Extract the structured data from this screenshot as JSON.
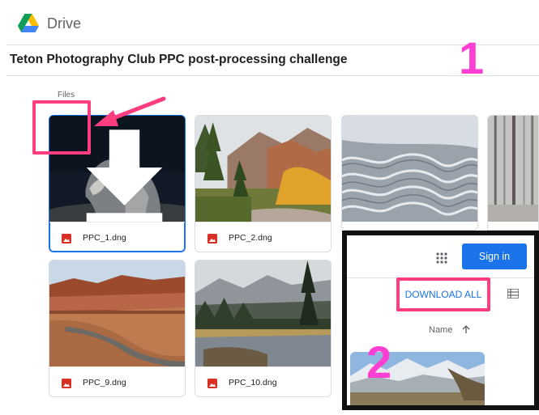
{
  "header": {
    "app_name": "Drive"
  },
  "folder": {
    "title": "Teton Photography Club PPC post-processing challenge",
    "section_label": "Files"
  },
  "files": [
    {
      "name": "PPC_1.dng"
    },
    {
      "name": "PPC_2.dng"
    },
    {
      "name": "PPC_9.dng"
    },
    {
      "name": "PPC_10.dng"
    }
  ],
  "inset": {
    "sign_in_label": "Sign in",
    "download_all_label": "DOWNLOAD ALL",
    "name_column_label": "Name"
  },
  "annotations": {
    "step_1": "1",
    "step_2": "2"
  },
  "icons": {
    "logo": "google-drive-icon",
    "file_type": "image-file-icon",
    "download": "download-icon",
    "apps": "apps-grid-icon",
    "list_view": "list-view-icon",
    "sort": "arrow-up-icon"
  },
  "colors": {
    "accent": "#1a73e8",
    "highlight": "#ff3d7f",
    "step_number": "#ff3ed4",
    "file_icon": "#d93025"
  }
}
